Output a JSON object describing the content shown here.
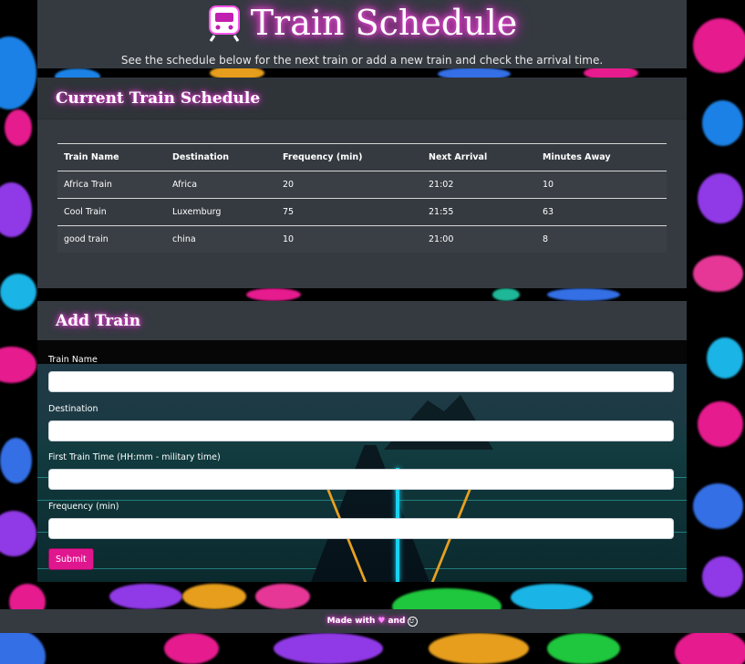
{
  "header": {
    "title": "Train Schedule",
    "subtitle": "See the schedule below for the next train or add a new train and check the arrival time.",
    "icon": "train-icon"
  },
  "schedule": {
    "title": "Current Train Schedule",
    "columns": [
      "Train Name",
      "Destination",
      "Frequency (min)",
      "Next Arrival",
      "Minutes Away"
    ],
    "rows": [
      [
        "Africa Train",
        "Africa",
        "20",
        "21:02",
        "10"
      ],
      [
        "Cool Train",
        "Luxemburg",
        "75",
        "21:55",
        "63"
      ],
      [
        "good train",
        "china",
        "10",
        "21:00",
        "8"
      ]
    ]
  },
  "add_train": {
    "title": "Add Train",
    "fields": {
      "train_name": {
        "label": "Train Name",
        "value": ""
      },
      "destination": {
        "label": "Destination",
        "value": ""
      },
      "first_time": {
        "label": "First Train Time (HH:mm - military time)",
        "value": ""
      },
      "frequency": {
        "label": "Frequency (min)",
        "value": ""
      }
    },
    "submit_label": "Submit"
  },
  "footer": {
    "made_with": "Made with",
    "and": "and",
    "heart_icon": "heart-icon",
    "smile_icon": "smile-icon"
  },
  "colors": {
    "panel": "#343a40",
    "neon_pink": "#e020c8",
    "submit": "#e0168f"
  }
}
